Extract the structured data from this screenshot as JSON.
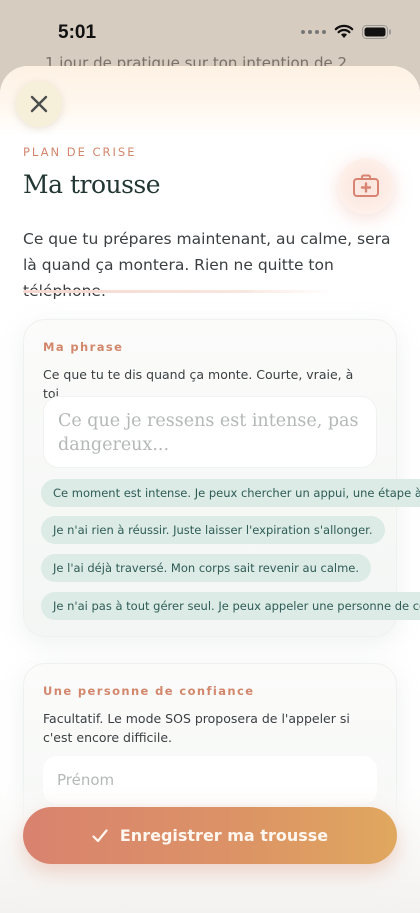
{
  "status": {
    "time": "5:01"
  },
  "background_screen": {
    "text": "1 jour de pratique sur ton intention de 2"
  },
  "header": {
    "eyebrow": "PLAN DE CRISE",
    "title": "Ma trousse",
    "intro": "Ce que tu prépares maintenant, au calme, sera là quand ça montera. Rien ne quitte ton téléphone."
  },
  "phrase_card": {
    "label": "Ma phrase",
    "description": "Ce que tu te dis quand ça monte. Courte, vraie, à toi.",
    "placeholder": "Ce que je ressens est intense, pas dangereux...",
    "suggestions": [
      "Ce moment est intense. Je peux chercher un appui, une étape à la fois",
      "Je n'ai rien à réussir. Juste laisser l'expiration s'allonger.",
      "Je l'ai déjà traversé. Mon corps sait revenir au calme.",
      "Je n'ai pas à tout gérer seul. Je peux appeler une personne de confiance"
    ]
  },
  "trust_card": {
    "label": "Une personne de confiance",
    "description": "Facultatif. Le mode SOS proposera de l'appeler si c'est encore difficile.",
    "first_name_placeholder": "Prénom"
  },
  "footer": {
    "save_label": "Enregistrer ma trousse"
  },
  "colors": {
    "accent": "#d2876c",
    "title": "#223633",
    "chip_bg": "#dcebe6",
    "chip_text": "#2f5c55",
    "button_start": "#d9826f",
    "button_end": "#e0a85f"
  },
  "icons": {
    "close": "close-icon",
    "kit": "first-aid-kit-icon",
    "check": "check-icon",
    "wifi": "wifi-icon",
    "battery": "battery-icon"
  }
}
